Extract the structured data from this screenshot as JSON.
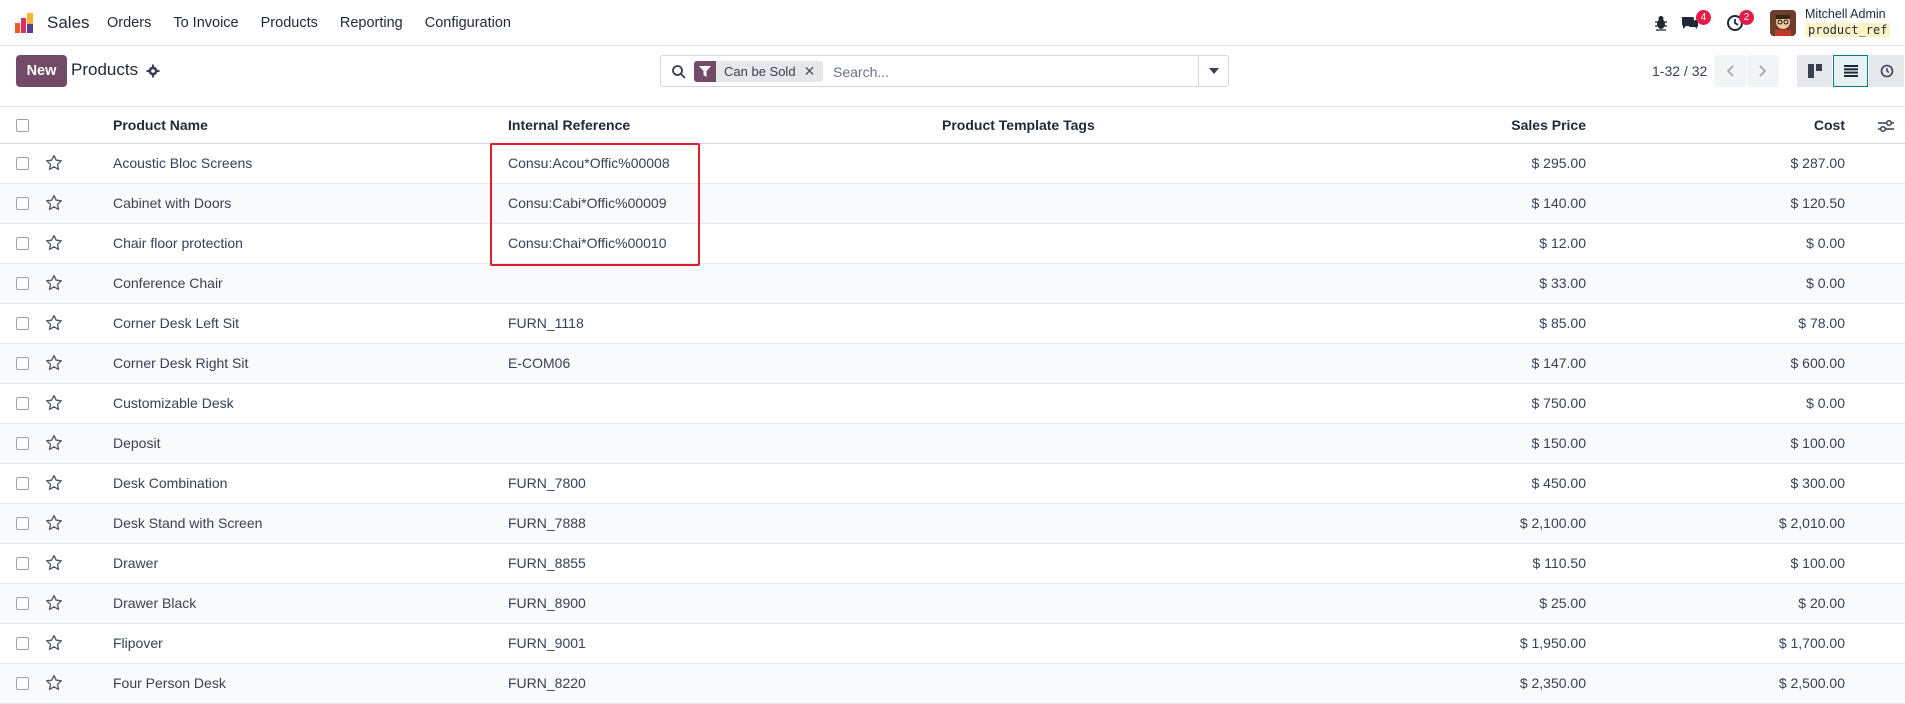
{
  "navbar": {
    "app_name": "Sales",
    "menu": [
      "Orders",
      "To Invoice",
      "Products",
      "Reporting",
      "Configuration"
    ],
    "messages_badge": "4",
    "activities_badge": "2",
    "user_name": "Mitchell Admin",
    "db_name": "product_ref"
  },
  "control_panel": {
    "new_label": "New",
    "title": "Products",
    "facet_label": "Can be Sold",
    "search_placeholder": "Search...",
    "pager": "1-32 / 32"
  },
  "table": {
    "headers": {
      "name": "Product Name",
      "ref": "Internal Reference",
      "tags": "Product Template Tags",
      "price": "Sales Price",
      "cost": "Cost"
    },
    "rows": [
      {
        "name": "Acoustic Bloc Screens",
        "ref": "Consu:Acou*Offic%00008",
        "price": "$ 295.00",
        "cost": "$ 287.00"
      },
      {
        "name": "Cabinet with Doors",
        "ref": "Consu:Cabi*Offic%00009",
        "price": "$ 140.00",
        "cost": "$ 120.50"
      },
      {
        "name": "Chair floor protection",
        "ref": "Consu:Chai*Offic%00010",
        "price": "$ 12.00",
        "cost": "$ 0.00"
      },
      {
        "name": "Conference Chair",
        "ref": "",
        "price": "$ 33.00",
        "cost": "$ 0.00"
      },
      {
        "name": "Corner Desk Left Sit",
        "ref": "FURN_1118",
        "price": "$ 85.00",
        "cost": "$ 78.00"
      },
      {
        "name": "Corner Desk Right Sit",
        "ref": "E-COM06",
        "price": "$ 147.00",
        "cost": "$ 600.00"
      },
      {
        "name": "Customizable Desk",
        "ref": "",
        "price": "$ 750.00",
        "cost": "$ 0.00"
      },
      {
        "name": "Deposit",
        "ref": "",
        "price": "$ 150.00",
        "cost": "$ 100.00"
      },
      {
        "name": "Desk Combination",
        "ref": "FURN_7800",
        "price": "$ 450.00",
        "cost": "$ 300.00"
      },
      {
        "name": "Desk Stand with Screen",
        "ref": "FURN_7888",
        "price": "$ 2,100.00",
        "cost": "$ 2,010.00"
      },
      {
        "name": "Drawer",
        "ref": "FURN_8855",
        "price": "$ 110.50",
        "cost": "$ 100.00"
      },
      {
        "name": "Drawer Black",
        "ref": "FURN_8900",
        "price": "$ 25.00",
        "cost": "$ 20.00"
      },
      {
        "name": "Flipover",
        "ref": "FURN_9001",
        "price": "$ 1,950.00",
        "cost": "$ 1,700.00"
      },
      {
        "name": "Four Person Desk",
        "ref": "FURN_8220",
        "price": "$ 2,350.00",
        "cost": "$ 2,500.00"
      }
    ]
  },
  "colors": {
    "brand": "#714b67",
    "active_view": "#017e84",
    "highlight": "#e11d2b",
    "badge": "#e11d48"
  }
}
